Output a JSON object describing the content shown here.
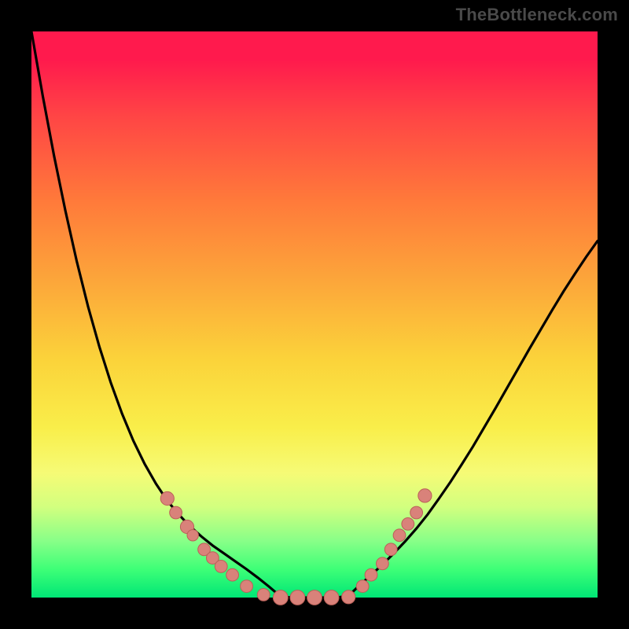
{
  "watermark": "TheBottleneck.com",
  "colors": {
    "frame": "#000000",
    "curve": "#000000",
    "marker_fill": "#d9827a",
    "marker_stroke": "#bb6058"
  },
  "chart_data": {
    "type": "line",
    "title": "",
    "xlabel": "",
    "ylabel": "",
    "xlim": [
      0,
      100
    ],
    "ylim": [
      0,
      100
    ],
    "grid": false,
    "x": [
      0,
      2,
      4,
      6,
      8,
      10,
      12,
      14,
      16,
      18,
      20,
      22,
      24,
      26,
      28,
      30,
      32,
      34,
      36,
      38,
      40,
      42,
      44,
      46,
      48,
      50,
      52,
      54,
      56,
      58,
      60,
      62,
      64,
      66,
      68,
      70,
      72,
      74,
      76,
      78,
      80,
      82,
      84,
      86,
      88,
      90,
      92,
      94,
      96,
      98,
      100
    ],
    "values": [
      100.0,
      88.6,
      78.0,
      68.3,
      59.4,
      51.4,
      44.3,
      38.0,
      32.5,
      27.7,
      23.6,
      20.1,
      17.1,
      14.7,
      12.6,
      10.8,
      9.2,
      7.8,
      6.4,
      5.0,
      3.5,
      1.9,
      0.2,
      0.0,
      0.0,
      0.0,
      0.0,
      0.0,
      0.3,
      2.2,
      4.0,
      5.8,
      7.8,
      9.9,
      12.2,
      14.7,
      17.5,
      20.4,
      23.5,
      26.7,
      30.1,
      33.5,
      37.0,
      40.5,
      44.0,
      47.4,
      50.8,
      54.1,
      57.2,
      60.2,
      63.0
    ],
    "markers": [
      {
        "x": 24.0,
        "y": 17.5,
        "r": 1.2
      },
      {
        "x": 25.5,
        "y": 15.0,
        "r": 1.1
      },
      {
        "x": 27.5,
        "y": 12.5,
        "r": 1.2
      },
      {
        "x": 28.5,
        "y": 11.0,
        "r": 1.0
      },
      {
        "x": 30.5,
        "y": 8.5,
        "r": 1.1
      },
      {
        "x": 32.0,
        "y": 7.0,
        "r": 1.1
      },
      {
        "x": 33.5,
        "y": 5.5,
        "r": 1.1
      },
      {
        "x": 35.5,
        "y": 4.0,
        "r": 1.1
      },
      {
        "x": 38.0,
        "y": 2.0,
        "r": 1.1
      },
      {
        "x": 41.0,
        "y": 0.5,
        "r": 1.1
      },
      {
        "x": 44.0,
        "y": 0.0,
        "r": 1.3
      },
      {
        "x": 47.0,
        "y": 0.0,
        "r": 1.3
      },
      {
        "x": 50.0,
        "y": 0.0,
        "r": 1.3
      },
      {
        "x": 53.0,
        "y": 0.0,
        "r": 1.3
      },
      {
        "x": 56.0,
        "y": 0.1,
        "r": 1.2
      },
      {
        "x": 58.5,
        "y": 2.0,
        "r": 1.1
      },
      {
        "x": 60.0,
        "y": 4.0,
        "r": 1.1
      },
      {
        "x": 62.0,
        "y": 6.0,
        "r": 1.1
      },
      {
        "x": 63.5,
        "y": 8.5,
        "r": 1.1
      },
      {
        "x": 65.0,
        "y": 11.0,
        "r": 1.1
      },
      {
        "x": 66.5,
        "y": 13.0,
        "r": 1.1
      },
      {
        "x": 68.0,
        "y": 15.0,
        "r": 1.1
      },
      {
        "x": 69.5,
        "y": 18.0,
        "r": 1.2
      }
    ]
  }
}
